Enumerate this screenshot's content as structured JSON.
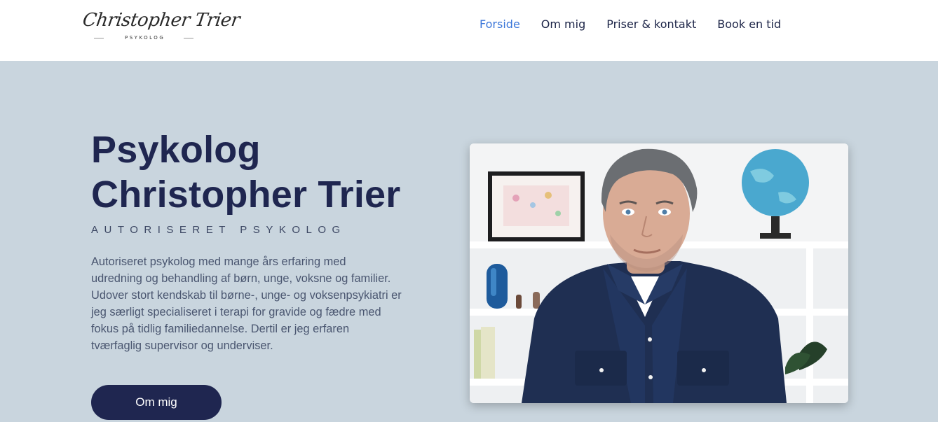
{
  "header": {
    "logo_script": "Christopher Trier",
    "logo_subtitle": "PSYKOLOG"
  },
  "nav": {
    "items": [
      {
        "label": "Forside",
        "active": true
      },
      {
        "label": "Om mig",
        "active": false
      },
      {
        "label": "Priser & kontakt",
        "active": false
      },
      {
        "label": "Book en tid",
        "active": false
      }
    ]
  },
  "hero": {
    "title_line1": "Psykolog",
    "title_line2": "Christopher Trier",
    "subtitle": "AUTORISERET PSYKOLOG",
    "description_lines": [
      "Autoriseret psykolog med mange års erfaring med",
      "udredning og behandling af børn, unge, voksne og familier.",
      "Udover stort kendskab til børne-, unge- og voksenpsykiatri er",
      "jeg særligt specialiseret i terapi for gravide og fædre med",
      "fokus på tidlig familiedannelse. Dertil er jeg erfaren",
      "tværfaglig supervisor og underviser."
    ],
    "button_label": "Om mig"
  },
  "colors": {
    "navy": "#1f2650",
    "accent": "#3b76d9",
    "hero_bg": "#c9d5de",
    "header_bg": "#ffffff"
  }
}
